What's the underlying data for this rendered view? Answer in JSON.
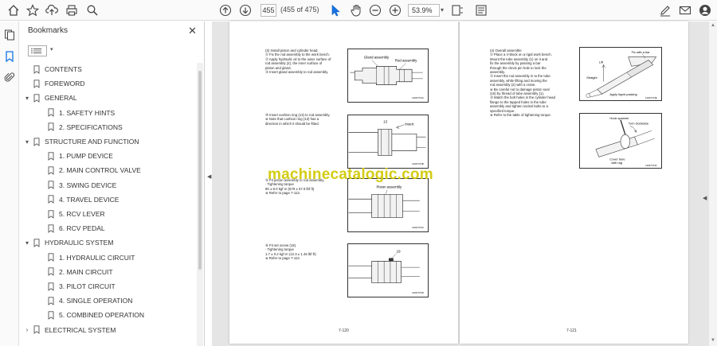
{
  "toolbar": {
    "page_current": "455",
    "page_count": "(455 of 475)",
    "zoom": "53.9%",
    "icons": [
      "home-icon",
      "bookmark-star-icon",
      "upload-icon",
      "print-icon",
      "search-icon",
      "prev-page-icon",
      "next-page-icon",
      "select-cursor-icon",
      "hand-icon",
      "zoom-out-icon",
      "zoom-in-icon",
      "fit-page-icon",
      "read-mode-icon",
      "sign-icon",
      "email-icon",
      "account-icon"
    ]
  },
  "bookmarks": {
    "title": "Bookmarks",
    "items": [
      {
        "label": "CONTENTS",
        "level": 0,
        "expander": ""
      },
      {
        "label": "FOREWORD",
        "level": 0,
        "expander": ""
      },
      {
        "label": "GENERAL",
        "level": 0,
        "expander": "▾"
      },
      {
        "label": "1. SAFETY HINTS",
        "level": 1,
        "expander": ""
      },
      {
        "label": "2. SPECIFICATIONS",
        "level": 1,
        "expander": ""
      },
      {
        "label": "STRUCTURE AND FUNCTION",
        "level": 0,
        "expander": "▾"
      },
      {
        "label": "1. PUMP DEVICE",
        "level": 1,
        "expander": ""
      },
      {
        "label": "2. MAIN CONTROL VALVE",
        "level": 1,
        "expander": ""
      },
      {
        "label": "3. SWING DEVICE",
        "level": 1,
        "expander": ""
      },
      {
        "label": "4. TRAVEL DEVICE",
        "level": 1,
        "expander": ""
      },
      {
        "label": "5. RCV LEVER",
        "level": 1,
        "expander": ""
      },
      {
        "label": "6. RCV PEDAL",
        "level": 1,
        "expander": ""
      },
      {
        "label": "HYDRAULIC SYSTEM",
        "level": 0,
        "expander": "▾"
      },
      {
        "label": "1. HYDRAULIC CIRCUIT",
        "level": 1,
        "expander": ""
      },
      {
        "label": "2. MAIN CIRCUIT",
        "level": 1,
        "expander": ""
      },
      {
        "label": "3. PILOT CIRCUIT",
        "level": 1,
        "expander": ""
      },
      {
        "label": "4. SINGLE OPERATION",
        "level": 1,
        "expander": ""
      },
      {
        "label": "5. COMBINED OPERATION",
        "level": 1,
        "expander": ""
      },
      {
        "label": "ELECTRICAL SYSTEM",
        "level": 0,
        "expander": "›"
      }
    ]
  },
  "left_page": {
    "sec1": [
      "(3) Install piston and cylinder head.",
      "① Fix the rod assembly to the work bench.",
      "② Apply hydraulic oil to the outer surface of",
      "    rod assembly (2), the inner surface of",
      "    piston and gland.",
      "③ Insert gland assembly to rod assembly."
    ],
    "fig1_labels": [
      "Gland assembly",
      "Rod assembly",
      "14027OT4A"
    ],
    "sec2": [
      "④ Insert cushion ring (13) to rod assembly.",
      "※ Note that cushion ring (13) has a",
      "    direction in which it should be fitted."
    ],
    "fig2_labels": [
      "13",
      "Insert",
      "14027OT4B"
    ],
    "sec3": [
      "⑤ Fit piston assembly to rod assembly.",
      "   · Tightening torque",
      "     80 ± 8.0 kgf·m (579 ± 57.9 lbf·ft)",
      "※ Refer to page 7-113."
    ],
    "fig3_labels": [
      "Piston assembly",
      "14027OT4C"
    ],
    "sec4": [
      "⑥ Fit set screw (19).",
      "   · Tightening torque",
      "     1.7 ± 0.2 kgf·m (12.3 ± 1.45 lbf·ft)",
      "※ Refer to page 7-113."
    ],
    "fig4_labels": [
      "19",
      "14027OT4D"
    ],
    "page_number": "7-120"
  },
  "right_page": {
    "sec1": [
      "(4) Overall assemble",
      "① Place a V-block on a rigid work bench.",
      "    Mount the tube assembly (1) on it and",
      "    fix the assembly by passing a bar",
      "    through the clevis pin hole to lock the",
      "    assembly.",
      "② Insert the rod assembly in to the tube",
      "    assembly, while lifting and moving the",
      "    rod assembly (2) with a crane.",
      "※ Be careful not to damage piston seal",
      "    (16) by thread of tube assembly (1).",
      "③ Match the bolt holes in the cylinder head",
      "    flange to the tapped holes in the tube",
      "    assembly and tighten socket bolts to a",
      "    specified torque.",
      "※ Refer to the table of tightening torque."
    ],
    "fig1_labels": [
      "Fix with a bar",
      "Lift",
      "Straight",
      "Apply liquid packing",
      "14027OT4E"
    ],
    "fig2_labels": [
      "Hook spanner",
      "Turn clockwise",
      "Cover here",
      "with rag",
      "14027OT4F"
    ],
    "page_number": "7-121"
  },
  "watermark": "machinecatalogic.com"
}
